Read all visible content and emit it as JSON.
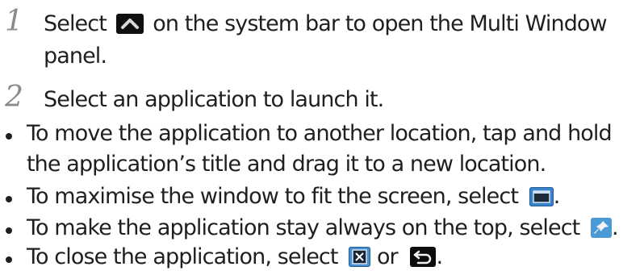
{
  "steps": [
    {
      "number": "1",
      "text_before_icon": "Select",
      "icon": "chevron-up-icon",
      "text_after_icon": "on the system bar to open the Multi Window",
      "continuation": "panel."
    },
    {
      "number": "2",
      "text": "Select an application to launch it."
    }
  ],
  "bullets": [
    {
      "line1": "To move the application to another location, tap and hold",
      "line2": "the application’s title and drag it to a new location."
    },
    {
      "text": "To maximise the window to fit the screen, select",
      "icon": "maximise-window-icon",
      "end": "."
    },
    {
      "text": "To make the application stay always on the top, select",
      "icon": "pin-icon",
      "end": "."
    },
    {
      "text": "To close the application, select",
      "icon1": "close-x-icon",
      "or": "or",
      "icon2": "back-arrow-icon",
      "end": "."
    }
  ],
  "colors": {
    "text": "#1f1f1f",
    "step_number": "#8a8a8a",
    "icon_blue": "#3b82c8",
    "icon_dark": "#101010"
  }
}
